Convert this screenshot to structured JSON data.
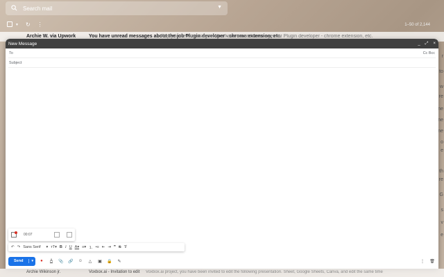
{
  "search": {
    "placeholder": "Search mail"
  },
  "pager": "1–50 of 2,144",
  "bg_rows": [
    {
      "sender": "Archie W. via Upwork",
      "subject": "You have unread messages about the job Plugin developer - chrome extension, etc.",
      "snippet": "Reply to new messages. You have unread messages for Plugin developer - chrome extension, etc."
    },
    {
      "sender": "Archie Wikinson jr.",
      "subject": "Voxbox.ai - Invitation to edit",
      "snippet": "Voxbox.ai project, you have been invited to edit the following presentation. Sheet, Google Sheets, Canva, and edit the same time"
    }
  ],
  "compose": {
    "title": "New Message",
    "minimize": "_",
    "expand": "⤢",
    "close": "×",
    "to_label": "To",
    "cc_bcc": "Cc Bcc",
    "subject_placeholder": "Subject",
    "attachment_time": "00:07",
    "font": "Sans Serif",
    "send_label": "Send"
  },
  "side_letters": [
    "r",
    "to",
    "w",
    "re",
    "ne",
    "ne",
    "ne",
    "o",
    "e",
    "th",
    "re",
    "G",
    "s",
    "v",
    "e"
  ]
}
